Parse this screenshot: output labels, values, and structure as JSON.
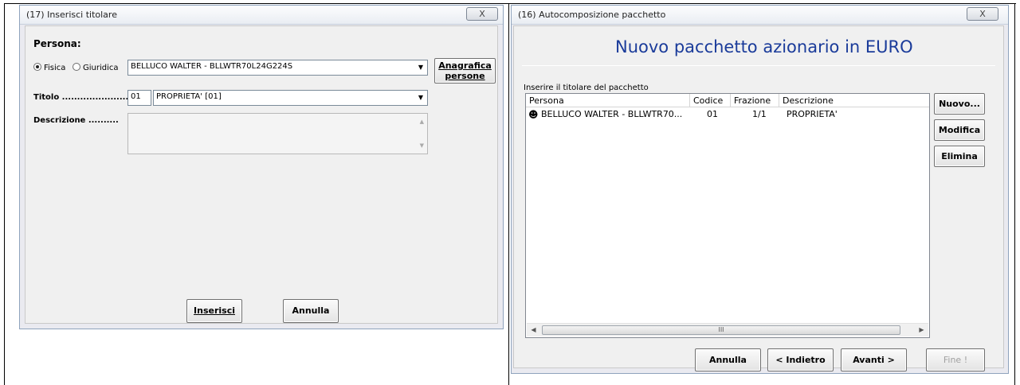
{
  "left_window": {
    "title": "(17) Inserisci titolare",
    "close_glyph": "X",
    "persona_label": "Persona:",
    "radio_fisica": "Fisica",
    "radio_giuridica": "Giuridica",
    "persona_value": "BELLUCO WALTER - BLLWTR70L24G224S",
    "anagrafica_button_line1": "Anagrafica",
    "anagrafica_button_line2": "persone",
    "titolo_label": "Titolo ......................",
    "titolo_code": "01",
    "titolo_value": "PROPRIETA' [01]",
    "descrizione_label": "Descrizione ..........",
    "descrizione_value": "",
    "inserisci_button": "Inserisci",
    "annulla_button": "Annulla"
  },
  "right_window": {
    "title": "(16) Autocomposizione pacchetto",
    "close_glyph": "X",
    "heading": "Nuovo pacchetto azionario in EURO",
    "instruction": "Inserire il titolare del pacchetto",
    "columns": [
      "Persona",
      "Codice",
      "Frazione",
      "Descrizione"
    ],
    "rows": [
      {
        "persona": "BELLUCO WALTER - BLLWTR70...",
        "codice": "01",
        "frazione": "1/1",
        "descrizione": "PROPRIETA'"
      }
    ],
    "scroll_thumb_glyph": "III",
    "nuovo_button": "Nuovo...",
    "modifica_button": "Modifica",
    "elimina_button": "Elimina",
    "annulla_button": "Annulla",
    "indietro_button": "< Indietro",
    "avanti_button": "Avanti >",
    "fine_button": "Fine !"
  }
}
